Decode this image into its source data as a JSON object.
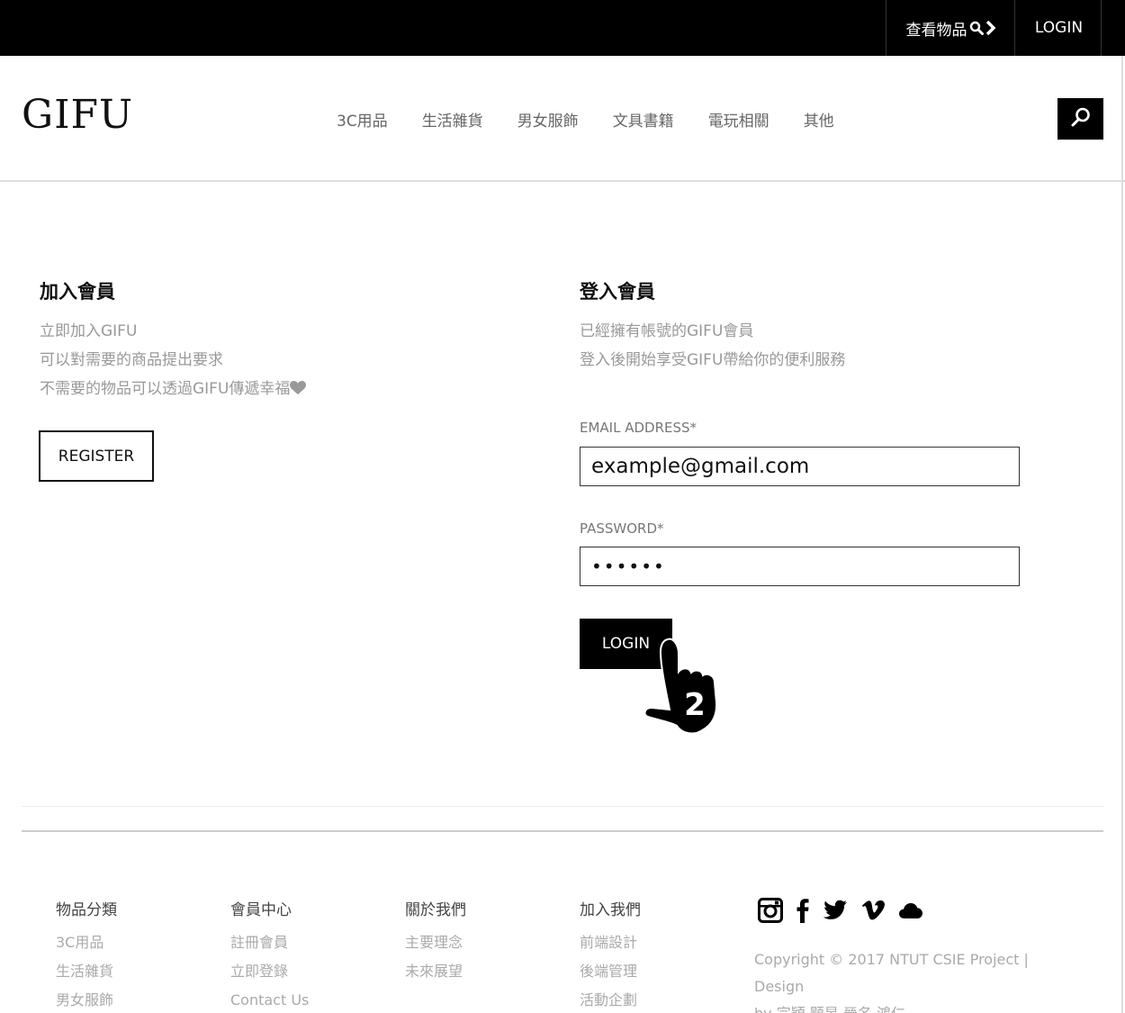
{
  "topbar": {
    "view_items": "查看物品",
    "login": "LOGIN"
  },
  "header": {
    "logo": "GIFU",
    "nav": [
      "3C用品",
      "生活雜貨",
      "男女服飾",
      "文具書籍",
      "電玩相關",
      "其他"
    ]
  },
  "register": {
    "title": "加入會員",
    "lines": [
      "立即加入GIFU",
      "可以對需要的商品提出要求",
      "不需要的物品可以透過GIFU傳遞幸福"
    ],
    "button": "REGISTER"
  },
  "login": {
    "title": "登入會員",
    "lines": [
      "已經擁有帳號的GIFU會員",
      "登入後開始享受GIFU帶給你的便利服務"
    ],
    "email_label": "EMAIL ADDRESS*",
    "email_value": "example@gmail.com",
    "password_label": "PASSWORD*",
    "password_value": "••••••",
    "button": "LOGIN",
    "step_number": "2"
  },
  "footer": {
    "columns": [
      {
        "title": "物品分類",
        "links": [
          "3C用品",
          "生活雜貨",
          "男女服飾"
        ]
      },
      {
        "title": "會員中心",
        "links": [
          "註冊會員",
          "立即登錄",
          "Contact Us"
        ]
      },
      {
        "title": "關於我們",
        "links": [
          "主要理念",
          "未來展望"
        ]
      },
      {
        "title": "加入我們",
        "links": [
          "前端設計",
          "後端管理",
          "活動企劃"
        ]
      }
    ],
    "social_icons": [
      "instagram-icon",
      "facebook-icon",
      "twitter-icon",
      "vimeo-icon",
      "cloud-icon"
    ],
    "copyright_line1": "Copyright © 2017 NTUT CSIE Project | Design",
    "copyright_line2": "by  宗穎 顥旻 晉名 鴻仁"
  },
  "colors": {
    "bar": "#000000",
    "muted_text": "#999999"
  }
}
